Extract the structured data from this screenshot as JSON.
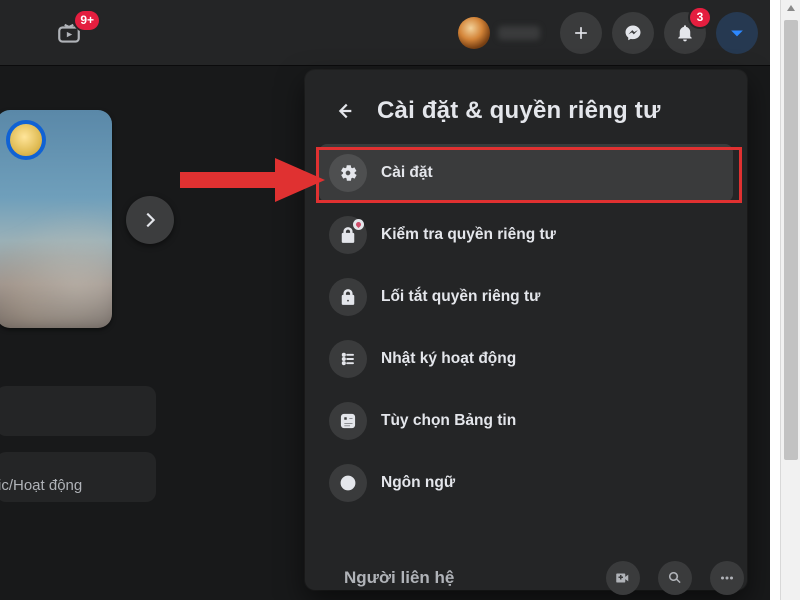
{
  "topbar": {
    "watch_badge": "9+",
    "notif_badge": "3"
  },
  "dropdown": {
    "title": "Cài đặt & quyền riêng tư",
    "items": [
      {
        "icon": "gear",
        "label": "Cài đặt"
      },
      {
        "icon": "lock-heart",
        "label": "Kiểm tra quyền riêng tư"
      },
      {
        "icon": "lock",
        "label": "Lối tắt quyền riêng tư"
      },
      {
        "icon": "list",
        "label": "Nhật ký hoạt động"
      },
      {
        "icon": "feed",
        "label": "Tùy chọn Bảng tin"
      },
      {
        "icon": "globe",
        "label": "Ngôn ngữ"
      }
    ]
  },
  "left": {
    "truncated_label": "ic/Hoạt động"
  },
  "bottom": {
    "contacts_label": "Người liên hệ"
  },
  "colors": {
    "bg": "#18191a",
    "panel": "#242526",
    "hover": "#3a3b3c",
    "text": "#e4e6eb",
    "muted": "#b0b3b8",
    "accent": "#2d88ff",
    "annot": "#e03131"
  }
}
